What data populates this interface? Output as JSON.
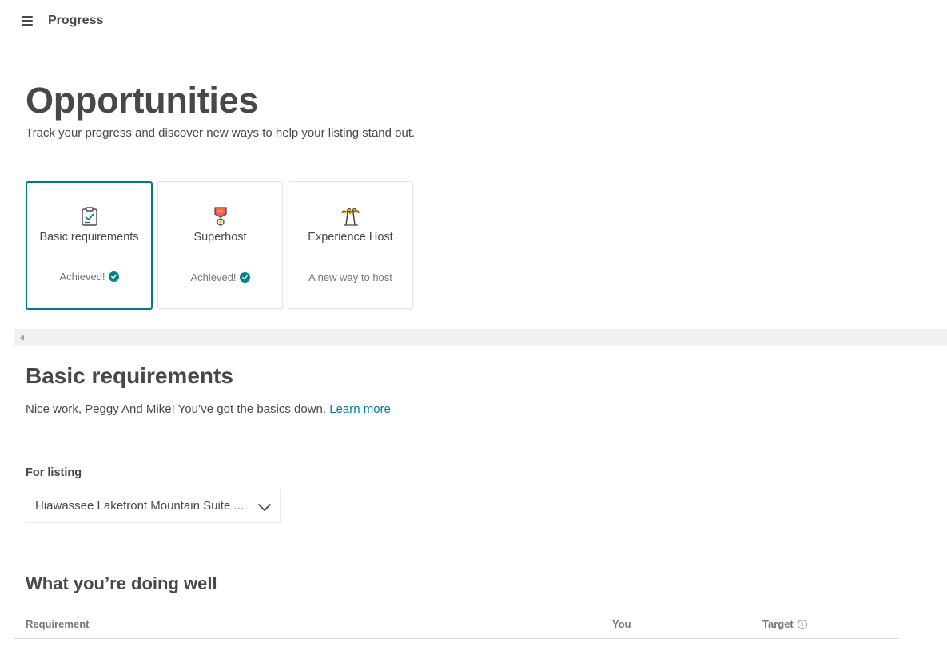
{
  "topbar": {
    "menu_icon": "hamburger-icon",
    "title": "Progress"
  },
  "hero": {
    "title": "Opportunities",
    "subtitle": "Track your progress and discover new ways to help your listing stand out."
  },
  "cards": [
    {
      "title": "Basic requirements",
      "status": "Achieved!",
      "icon": "clipboard-check-icon",
      "achieved": true,
      "selected": true
    },
    {
      "title": "Superhost",
      "status": "Achieved!",
      "icon": "superhost-medal-icon",
      "achieved": true,
      "selected": false
    },
    {
      "title": "Experience Host",
      "status": "A new way to host",
      "icon": "palm-trees-icon",
      "achieved": false,
      "selected": false
    }
  ],
  "section": {
    "title": "Basic requirements",
    "description": "Nice work, Peggy And Mike! You’ve got the basics down.",
    "link_text": "Learn more"
  },
  "listing": {
    "label": "For listing",
    "selected_value": "Hiawassee Lakefront Mountain Suite ..."
  },
  "doing_well": {
    "title": "What you’re doing well",
    "columns": [
      "Requirement",
      "You",
      "Target"
    ]
  },
  "colors": {
    "accent": "#008489",
    "selected_border": "#007a87",
    "text": "#484848",
    "muted": "#767676"
  }
}
